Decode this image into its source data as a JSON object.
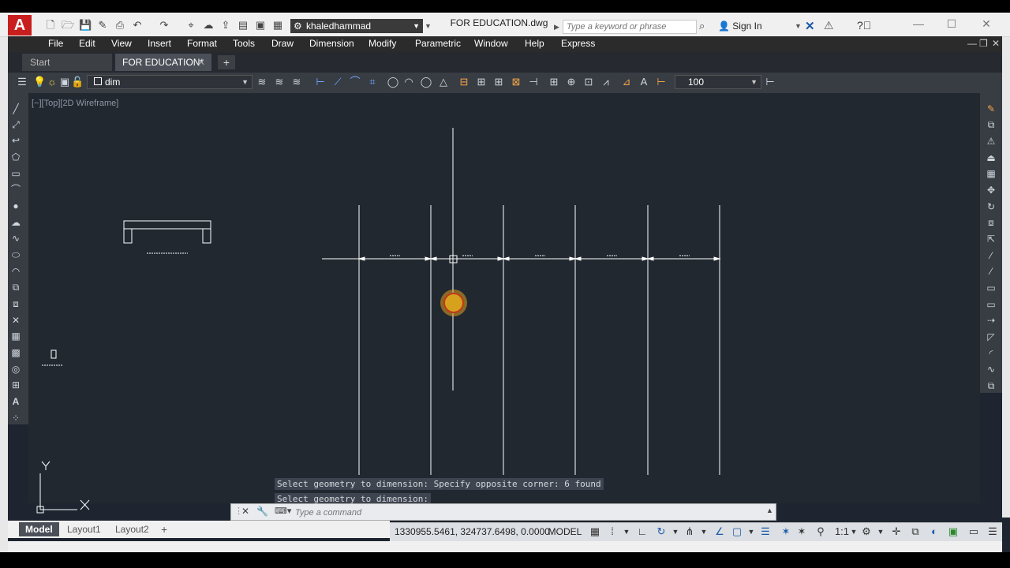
{
  "quick_access": {
    "workspace": "khaledhammad"
  },
  "window": {
    "title": "FOR EDUCATION.dwg"
  },
  "search": {
    "placeholder": "Type a keyword or phrase"
  },
  "account": {
    "sign_in": "Sign In"
  },
  "menu": {
    "items": [
      "File",
      "Edit",
      "View",
      "Insert",
      "Format",
      "Tools",
      "Draw",
      "Dimension",
      "Modify",
      "Parametric",
      "Window",
      "Help",
      "Express"
    ]
  },
  "tabs": {
    "start": "Start",
    "document": "FOR EDUCATION*"
  },
  "toolbar": {
    "layer": "dim",
    "dim_scale": "100"
  },
  "viewport": {
    "label": "[−][Top][2D Wireframe]"
  },
  "command": {
    "history_1": "Select geometry to dimension: Specify opposite corner: 6 found",
    "history_2": "Select geometry to dimension:",
    "placeholder": "Type a command"
  },
  "layout_tabs": [
    "Model",
    "Layout1",
    "Layout2"
  ],
  "status": {
    "coordinates": "1330955.5461, 324737.6498, 0.0000",
    "space": "MODEL",
    "annotation_scale": "1:1"
  },
  "colors": {
    "canvas": "#212830",
    "drawing_lines": "#ffffff",
    "accent": "#c81e1e",
    "cursor_marker": "#e0a020"
  }
}
